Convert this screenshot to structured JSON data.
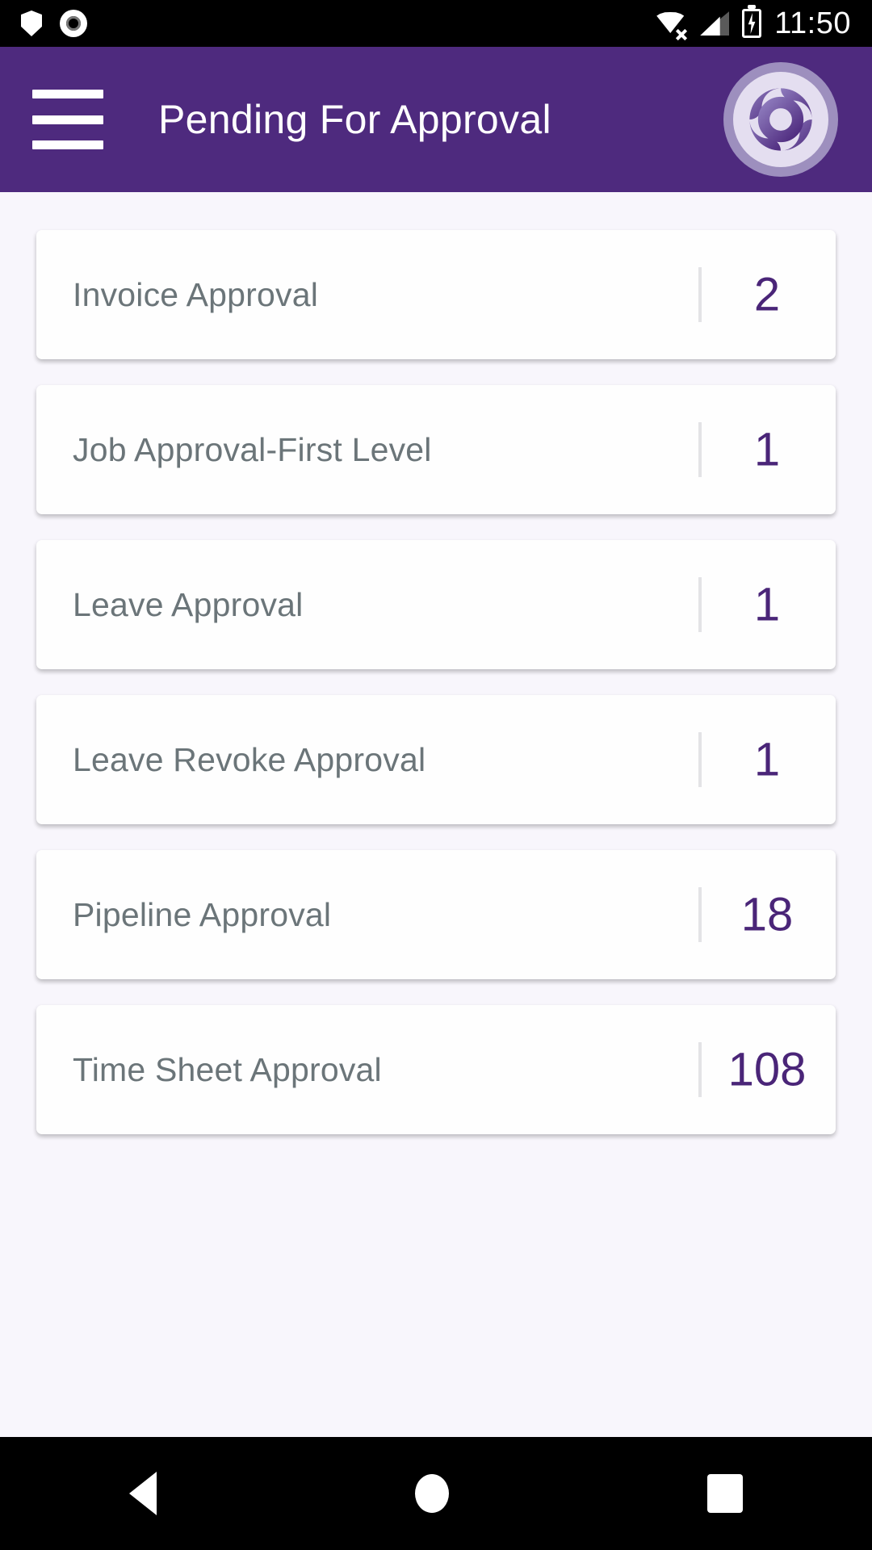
{
  "status_bar": {
    "time": "11:50",
    "icons": [
      "shield-icon",
      "record-icon",
      "wifi-off-icon",
      "cellular-signal-icon",
      "battery-charging-icon"
    ]
  },
  "app_bar": {
    "title": "Pending For Approval",
    "menu_icon": "hamburger-menu-icon",
    "logo_icon": "brand-swirl-logo",
    "background_color": "#4E2A7E"
  },
  "theme": {
    "primary": "#4E2A7E",
    "count_color": "#4A2578",
    "label_color": "#6B7579",
    "page_background": "#F8F6FC",
    "card_background": "#FEFEFE"
  },
  "approval_list": [
    {
      "label": "Invoice Approval",
      "count": "2"
    },
    {
      "label": "Job Approval-First Level",
      "count": "1"
    },
    {
      "label": "Leave Approval",
      "count": "1"
    },
    {
      "label": "Leave Revoke Approval",
      "count": "1"
    },
    {
      "label": "Pipeline Approval",
      "count": "18"
    },
    {
      "label": "Time Sheet Approval",
      "count": "108"
    }
  ],
  "nav_bar": {
    "back": "back-triangle-icon",
    "home": "home-circle-icon",
    "recents": "recents-square-icon"
  }
}
